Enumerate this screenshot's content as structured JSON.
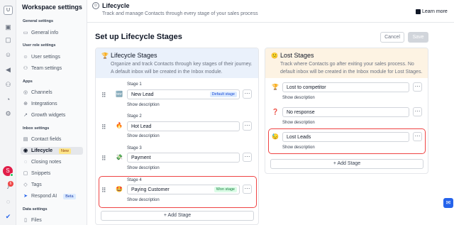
{
  "rail": {
    "avatar_letter": "U",
    "icons": [
      "layout-icon",
      "inbox-icon",
      "contacts-icon",
      "broadcast-icon",
      "workflow-icon",
      "reports-icon",
      "settings-icon"
    ],
    "user_avatar_letter": "S",
    "notification_count": "6"
  },
  "sidebar": {
    "title": "Workspace settings",
    "sections": [
      {
        "label": "General settings",
        "items": [
          {
            "label": "General info",
            "icon": "info-icon"
          }
        ]
      },
      {
        "label": "User role settings",
        "items": [
          {
            "label": "User settings",
            "icon": "user-icon"
          },
          {
            "label": "Team settings",
            "icon": "team-icon"
          }
        ]
      },
      {
        "label": "Apps",
        "items": [
          {
            "label": "Channels",
            "icon": "channels-icon"
          },
          {
            "label": "Integrations",
            "icon": "integrations-icon"
          },
          {
            "label": "Growth widgets",
            "icon": "growth-icon"
          }
        ]
      },
      {
        "label": "Inbox settings",
        "items": [
          {
            "label": "Contact fields",
            "icon": "fields-icon"
          },
          {
            "label": "Lifecycle",
            "icon": "lifecycle-icon",
            "badge": "New",
            "active": true
          },
          {
            "label": "Closing notes",
            "icon": "notes-icon"
          },
          {
            "label": "Snippets",
            "icon": "snippets-icon"
          },
          {
            "label": "Tags",
            "icon": "tag-icon"
          },
          {
            "label": "Respond AI",
            "icon": "ai-icon",
            "badge": "Beta"
          }
        ]
      },
      {
        "label": "Data settings",
        "items": [
          {
            "label": "Files",
            "icon": "files-icon"
          }
        ]
      }
    ]
  },
  "header": {
    "title": "Lifecycle",
    "subtitle": "Track and manage Contacts through every stage of your sales process",
    "learn_more": "Learn more"
  },
  "page": {
    "title": "Set up Lifecycle Stages",
    "cancel_label": "Cancel",
    "save_label": "Save"
  },
  "lifecycle": {
    "icon": "🏆",
    "title": "Lifecycle Stages",
    "description": "Organize and track Contacts through key stages of their journey. A default inbox will be created in the Inbox module.",
    "stages": [
      {
        "label": "Stage 1",
        "emoji": "🆕",
        "name": "New Lead",
        "badge": "Default stage",
        "show_description": "Show description"
      },
      {
        "label": "Stage 2",
        "emoji": "🔥",
        "name": "Hot Lead",
        "badge": "",
        "show_description": "Show description"
      },
      {
        "label": "Stage 3",
        "emoji": "💸",
        "name": "Payment",
        "badge": "",
        "show_description": "Show description"
      },
      {
        "label": "Stage 4",
        "emoji": "🤩",
        "name": "Paying Customer",
        "badge": "Won stage",
        "show_description": "Show description"
      }
    ],
    "add_stage": "+ Add Stage"
  },
  "lost": {
    "icon": "😕",
    "title": "Lost Stages",
    "description": "Track where Contacts go after exiting your sales process. No default inbox will be created in the Inbox module for Lost Stages.",
    "stages": [
      {
        "emoji": "🏆",
        "name": "Lost to competitor",
        "show_description": "Show description"
      },
      {
        "emoji": "❓",
        "name": "No response",
        "show_description": "Show description"
      },
      {
        "emoji": "😓",
        "name": "Lost Leads",
        "show_description": "Show description"
      }
    ],
    "add_stage": "+ Add Stage"
  },
  "colors": {
    "lifecycle_header_bg": "#eaf1fb",
    "lost_header_bg": "#fdf3e3",
    "highlight_border": "#ef4444",
    "won_badge": "#dcfce7",
    "default_badge": "#dbeafe"
  }
}
